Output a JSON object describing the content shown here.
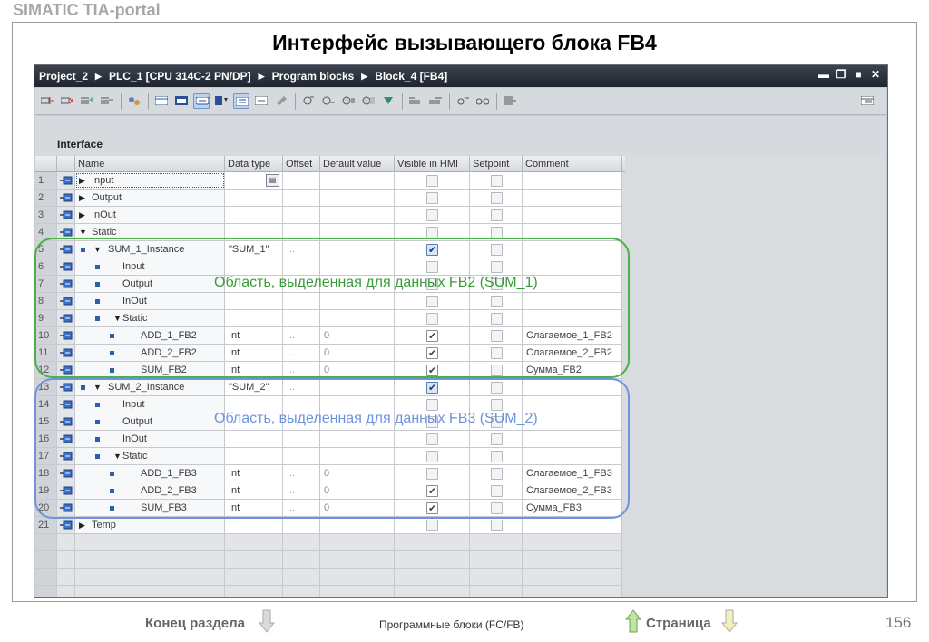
{
  "header": {
    "brand": "SIMATIC TIA-portal",
    "slide_title": "Интерфейс вызывающего блока FB4"
  },
  "window": {
    "breadcrumb": [
      "Project_2",
      "PLC_1 [CPU 314C-2 PN/DP]",
      "Program blocks",
      "Block_4 [FB4]"
    ],
    "controls": [
      "minimize",
      "restore",
      "float",
      "close"
    ],
    "interface_label": "Interface"
  },
  "table": {
    "columns": [
      "Name",
      "Data type",
      "Offset",
      "Default value",
      "Visible in HMI",
      "Setpoint",
      "Comment"
    ],
    "rows": [
      {
        "n": "1",
        "arrow": "▶",
        "name": "Input",
        "lvl": 0,
        "dt": "",
        "of": "",
        "dv": "",
        "hmi": "off",
        "sp": "off",
        "cm": "",
        "dtbtn": "1",
        "sel": "1"
      },
      {
        "n": "2",
        "arrow": "▶",
        "name": "Output",
        "lvl": 0,
        "dt": "",
        "of": "",
        "dv": "",
        "hmi": "off",
        "sp": "off",
        "cm": ""
      },
      {
        "n": "3",
        "arrow": "▶",
        "name": "InOut",
        "lvl": 0,
        "dt": "",
        "of": "",
        "dv": "",
        "hmi": "off",
        "sp": "off",
        "cm": ""
      },
      {
        "n": "4",
        "arrow": "▼",
        "name": "Static",
        "lvl": 0,
        "dt": "",
        "of": "",
        "dv": "",
        "hmi": "off",
        "sp": "off",
        "cm": ""
      },
      {
        "n": "5",
        "arrow": "▼",
        "sq": "1",
        "name": "SUM_1_Instance",
        "lvl": 1,
        "dt": "\"SUM_1\"",
        "of": "...",
        "dv": "",
        "hmi": "blue",
        "sp": "off",
        "cm": ""
      },
      {
        "n": "6",
        "sq": "1",
        "name": "Input",
        "lvl": 2,
        "dt": "",
        "of": "",
        "dv": "",
        "hmi": "off",
        "sp": "off",
        "cm": ""
      },
      {
        "n": "7",
        "sq": "1",
        "name": "Output",
        "lvl": 2,
        "dt": "",
        "of": "",
        "dv": "",
        "hmi": "off",
        "sp": "off",
        "cm": ""
      },
      {
        "n": "8",
        "sq": "1",
        "name": "InOut",
        "lvl": 2,
        "dt": "",
        "of": "",
        "dv": "",
        "hmi": "off",
        "sp": "off",
        "cm": ""
      },
      {
        "n": "9",
        "sq": "1",
        "arrow": "▼",
        "name": "Static",
        "lvl": 2,
        "dt": "",
        "of": "",
        "dv": "",
        "hmi": "off",
        "sp": "off",
        "cm": ""
      },
      {
        "n": "10",
        "sq": "1",
        "name": "ADD_1_FB2",
        "lvl": 3,
        "dt": "Int",
        "of": "...",
        "dv": "0",
        "hmi": "on",
        "sp": "off",
        "cm": "Слагаемое_1_FB2"
      },
      {
        "n": "11",
        "sq": "1",
        "name": "ADD_2_FB2",
        "lvl": 3,
        "dt": "Int",
        "of": "...",
        "dv": "0",
        "hmi": "on",
        "sp": "off",
        "cm": "Слагаемое_2_FB2"
      },
      {
        "n": "12",
        "sq": "1",
        "name": "SUM_FB2",
        "lvl": 3,
        "dt": "Int",
        "of": "...",
        "dv": "0",
        "hmi": "on",
        "sp": "off",
        "cm": "Сумма_FB2"
      },
      {
        "n": "13",
        "arrow": "▼",
        "sq": "1",
        "name": "SUM_2_Instance",
        "lvl": 1,
        "dt": "\"SUM_2\"",
        "of": "...",
        "dv": "",
        "hmi": "blue",
        "sp": "off",
        "cm": ""
      },
      {
        "n": "14",
        "sq": "1",
        "name": "Input",
        "lvl": 2,
        "dt": "",
        "of": "",
        "dv": "",
        "hmi": "off",
        "sp": "off",
        "cm": ""
      },
      {
        "n": "15",
        "sq": "1",
        "name": "Output",
        "lvl": 2,
        "dt": "",
        "of": "",
        "dv": "",
        "hmi": "off",
        "sp": "off",
        "cm": ""
      },
      {
        "n": "16",
        "sq": "1",
        "name": "InOut",
        "lvl": 2,
        "dt": "",
        "of": "",
        "dv": "",
        "hmi": "off",
        "sp": "off",
        "cm": ""
      },
      {
        "n": "17",
        "sq": "1",
        "arrow": "▼",
        "name": "Static",
        "lvl": 2,
        "dt": "",
        "of": "",
        "dv": "",
        "hmi": "off",
        "sp": "off",
        "cm": ""
      },
      {
        "n": "18",
        "sq": "1",
        "name": "ADD_1_FB3",
        "lvl": 3,
        "dt": "Int",
        "of": "...",
        "dv": "0",
        "hmi": "off",
        "sp": "off",
        "cm": "Слагаемое_1_FB3"
      },
      {
        "n": "19",
        "sq": "1",
        "name": "ADD_2_FB3",
        "lvl": 3,
        "dt": "Int",
        "of": "...",
        "dv": "0",
        "hmi": "on",
        "sp": "off",
        "cm": "Слагаемое_2_FB3"
      },
      {
        "n": "20",
        "sq": "1",
        "name": "SUM_FB3",
        "lvl": 3,
        "dt": "Int",
        "of": "...",
        "dv": "0",
        "hmi": "on",
        "sp": "off",
        "cm": "Сумма_FB3"
      },
      {
        "n": "21",
        "arrow": "▶",
        "name": "Temp",
        "lvl": 0,
        "dt": "",
        "of": "",
        "dv": "",
        "hmi": "off",
        "sp": "off",
        "cm": ""
      }
    ]
  },
  "regions": {
    "fb2_label": "Область, выделенная для данных FB2 (SUM_1)",
    "fb3_label": "Область, выделенная для данных FB3 (SUM_2)"
  },
  "footer": {
    "section_end": "Конец раздела",
    "center": "Программные блоки (FC/FB)",
    "page_label": "Страница",
    "page_number": "156"
  },
  "colors": {
    "region_green": "#4ab04a",
    "region_blue": "#6f94dc",
    "arrow_grey": "#dadada",
    "arrow_green": "#bfe6a4"
  }
}
